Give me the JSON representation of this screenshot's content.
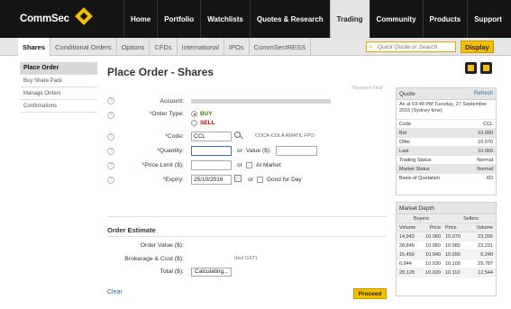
{
  "brand": {
    "name": "CommSec"
  },
  "top_nav": [
    "Home",
    "Portfolio",
    "Watchlists",
    "Quotes & Research",
    "Trading",
    "Community",
    "Products",
    "Support"
  ],
  "sub_nav": [
    "Shares",
    "Conditional Orders",
    "Options",
    "CFDs",
    "International",
    "IPOs",
    "CommSecIRESS"
  ],
  "quick_quote": {
    "placeholder": "Quick Quote or Search",
    "button": "Display"
  },
  "left_menu": [
    "Place Order",
    "Buy Share Pack",
    "Manage Orders",
    "Confirmations"
  ],
  "page": {
    "title": "Place Order - Shares",
    "required_note": "*Required Field"
  },
  "form": {
    "account_label": "Account:",
    "order_type_label": "Order Type:",
    "buy": "BUY",
    "sell": "SELL",
    "code_label": "Code:",
    "code_value": "CCL",
    "code_desc": "COCA-COLA AMATIL FPO",
    "quantity_label": "Quantity:",
    "or1": "or",
    "value_label": "Value ($):",
    "price_limit_label": "Price Limit ($):",
    "or2": "or",
    "at_market": "At Market",
    "expiry_label": "Expiry:",
    "expiry_value": "25/10/2016",
    "or3": "or",
    "good_for_day": "Good for Day"
  },
  "estimate": {
    "heading": "Order Estimate",
    "order_value_label": "Order Value ($):",
    "brokerage_label": "Brokerage & Cost ($):",
    "incl_gst": "(Incl GST)",
    "total_label": "Total ($):",
    "total_value": "Calculating..."
  },
  "actions": {
    "clear": "Clear",
    "proceed": "Proceed"
  },
  "quote": {
    "header": "Quote",
    "refresh": "Refresh",
    "as_at": "As at 03:48 PM Tuesday, 27 September 2016 (Sydney time)",
    "rows": [
      {
        "label": "Code",
        "value": "CCL"
      },
      {
        "label": "Bid",
        "value": "10.060"
      },
      {
        "label": "Offer",
        "value": "10.070"
      },
      {
        "label": "Last",
        "value": "10.060"
      },
      {
        "label": "Trading Status",
        "value": "Normal"
      },
      {
        "label": "Market Status",
        "value": "Normal"
      },
      {
        "label": "Basis of Quotation",
        "value": "XD"
      }
    ]
  },
  "depth": {
    "header": "Market Depth",
    "buyers": "Buyers",
    "sellers": "Sellers",
    "columns": [
      "Volume",
      "Price",
      "Price",
      "Volume"
    ],
    "rows": [
      [
        "14,943",
        "10.060",
        "10.070",
        "23,206"
      ],
      [
        "28,845",
        "10.050",
        "10.080",
        "23,231"
      ],
      [
        "15,450",
        "10.040",
        "10.090",
        "6,240"
      ],
      [
        "6,944",
        "10.030",
        "10.100",
        "29,787"
      ],
      [
        "28,128",
        "10.020",
        "10.110",
        "12,544"
      ]
    ]
  }
}
